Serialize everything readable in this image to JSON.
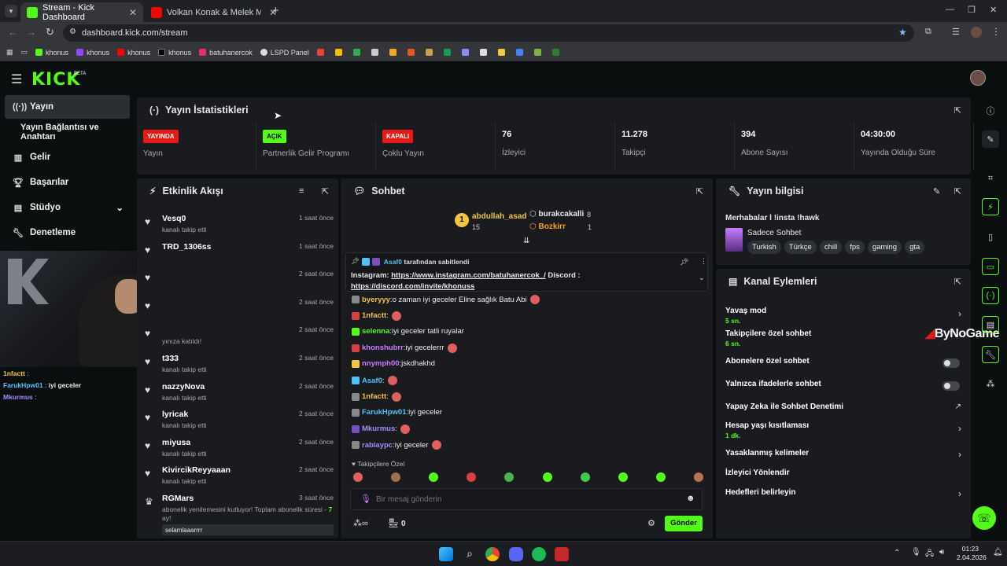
{
  "browser": {
    "tabs": [
      {
        "label": "Stream - Kick Dashboard",
        "active": true
      },
      {
        "label": "Volkan Konak & Melek Mosso ",
        "active": false
      }
    ],
    "url": "dashboard.kick.com/stream",
    "bookmarks": [
      "khonus",
      "khonus",
      "khonus",
      "khonus",
      "batuhanercok",
      "LSPD Panel"
    ]
  },
  "sidebar": {
    "items": [
      {
        "label": "Yayın"
      },
      {
        "label": "Yayın Bağlantısı ve Anahtarı"
      },
      {
        "label": "Gelir"
      },
      {
        "label": "Başarılar"
      },
      {
        "label": "Stüdyo"
      },
      {
        "label": "Denetleme"
      }
    ]
  },
  "stats": {
    "title": "Yayın İstatistikleri",
    "items": [
      {
        "value": "YAYINDA",
        "label": "Yayın",
        "kind": "badge",
        "color": "#e91916"
      },
      {
        "value": "AÇIK",
        "label": "Partnerlik Gelir Programı",
        "kind": "badge",
        "color": "#53fc18"
      },
      {
        "value": "KAPALI",
        "label": "Çoklu Yayın",
        "kind": "badge",
        "color": "#e91916"
      },
      {
        "value": "76",
        "label": "İzleyici",
        "kind": "num"
      },
      {
        "value": "11.278",
        "label": "Takipçi",
        "kind": "num"
      },
      {
        "value": "394",
        "label": "Abone Sayısı",
        "kind": "num"
      },
      {
        "value": "04:30:00",
        "label": "Yayında Olduğu Süre",
        "kind": "num"
      }
    ]
  },
  "activity": {
    "title": "Etkinlik Akışı",
    "items": [
      {
        "name": "Vesq0",
        "sub": "kanalı takip etti",
        "time": "1 saat önce"
      },
      {
        "name": "TRD_1306ss",
        "sub": "",
        "time": "1 saat önce"
      },
      {
        "name": "",
        "sub": "",
        "time": "2 saat önce"
      },
      {
        "name": "",
        "sub": "",
        "time": "2 saat önce"
      },
      {
        "name": "",
        "sub": "yınıza katıldı!",
        "time": "2 saat önce"
      },
      {
        "name": "t333",
        "sub": "kanalı takip etti",
        "time": "2 saat önce"
      },
      {
        "name": "nazzyNova",
        "sub": "kanalı takip etti",
        "time": "2 saat önce"
      },
      {
        "name": "lyricak",
        "sub": "kanalı takip etti",
        "time": "2 saat önce"
      },
      {
        "name": "miyusa",
        "sub": "kanalı takip etti",
        "time": "2 saat önce"
      },
      {
        "name": "KivircikReyyaaan",
        "sub": "kanalı takip etti",
        "time": "2 saat önce"
      }
    ],
    "last": {
      "name": "RGMars",
      "time": "3 saat önce",
      "sub": "abonelik yenilemesini kutluyor! Toplam abonelik süresi -",
      "months": "7",
      "months_suffix": " ay!",
      "msg": "selamlaaarrrr"
    }
  },
  "chat": {
    "title": "Sohbet",
    "top": [
      {
        "rank": "1",
        "name": "abdullah_asad",
        "count": "15"
      },
      {
        "name": "burakcakalli",
        "count": "8"
      },
      {
        "name": "Bozkirr",
        "count": "1"
      }
    ],
    "pinned": {
      "by": "Asaf0",
      "suffix": "tarafından sabitlendi",
      "text1": "Instagram: ",
      "link1": "https://www.instagram.com/batuhanercok_/",
      "text2": " Discord :",
      "link2": "https://discord.com/invite/khonuss"
    },
    "messages": [
      {
        "user": "byeryyy",
        "text": "o zaman iyi geceler Eline sağlık Batu Abi",
        "color": "#f5c542"
      },
      {
        "user": "1nfactt",
        "text": "",
        "color": "#f5c542"
      },
      {
        "user": "selenna",
        "text": "iyi geceler tatli ruyalar",
        "color": "#53fc18"
      },
      {
        "user": "khonshubrr",
        "text": "iyi gecelerrr",
        "color": "#c77dff"
      },
      {
        "user": "nnymph00",
        "text": "jskdhakhd",
        "color": "#c77dff"
      },
      {
        "user": "Asaf0",
        "text": "",
        "color": "#4fc3f7"
      },
      {
        "user": "1nfactt",
        "text": "",
        "color": "#f5c542"
      },
      {
        "user": "FarukHpw01",
        "text": "iyi geceler",
        "color": "#4fc3f7"
      },
      {
        "user": "Mkurmus",
        "text": "",
        "color": "#a78bfa"
      },
      {
        "user": "rabiaypc",
        "text": "iyi geceler",
        "color": "#a78bfa"
      }
    ],
    "followers_only": "Takipçilere Özel",
    "placeholder": "Bir mesaj gönderin",
    "points": "0",
    "send": "Gönder"
  },
  "info": {
    "title": "Yayın bilgisi",
    "stream_title": "Merhabalar l !insta !hawk",
    "category": "Sadece Sohbet",
    "tags": [
      "Turkish",
      "Türkçe",
      "chill",
      "fps",
      "gaming",
      "gta"
    ]
  },
  "actions": {
    "title": "Kanal Eylemleri",
    "items": [
      {
        "label": "Yavaş mod",
        "sub": "5 sn.",
        "type": "chevron"
      },
      {
        "label": "Takipçilere özel sohbet",
        "sub": "6 sn.",
        "type": "none"
      },
      {
        "label": "Abonelere özel sohbet",
        "sub": "",
        "type": "toggle"
      },
      {
        "label": "Yalnızca ifadelerle sohbet",
        "sub": "",
        "type": "toggle"
      },
      {
        "label": "Yapay Zeka ile Sohbet Denetimi",
        "sub": "",
        "type": "ext"
      },
      {
        "label": "Hesap yaşı kısıtlaması",
        "sub": "1 dk.",
        "type": "chevron"
      },
      {
        "label": "Yasaklanmış kelimeler",
        "sub": "",
        "type": "chevron"
      },
      {
        "label": "İzleyici Yönlendir",
        "sub": "",
        "type": "none"
      },
      {
        "label": "Hedefleri belirleyin",
        "sub": "",
        "type": "chevron"
      }
    ]
  },
  "overlay": {
    "watermark": "ByNoGame",
    "chat": [
      {
        "user": "1nfactt",
        "text": ""
      },
      {
        "user": "FarukHpw01",
        "text": "iyi geceler"
      },
      {
        "user": "Mkurmus",
        "text": ""
      }
    ]
  },
  "taskbar": {
    "time": "01:23",
    "date": "2.04.2026"
  },
  "colors": {
    "accent": "#53fc18",
    "live": "#e91916",
    "panel": "#191b1f",
    "bg": "#0b0e0f"
  }
}
